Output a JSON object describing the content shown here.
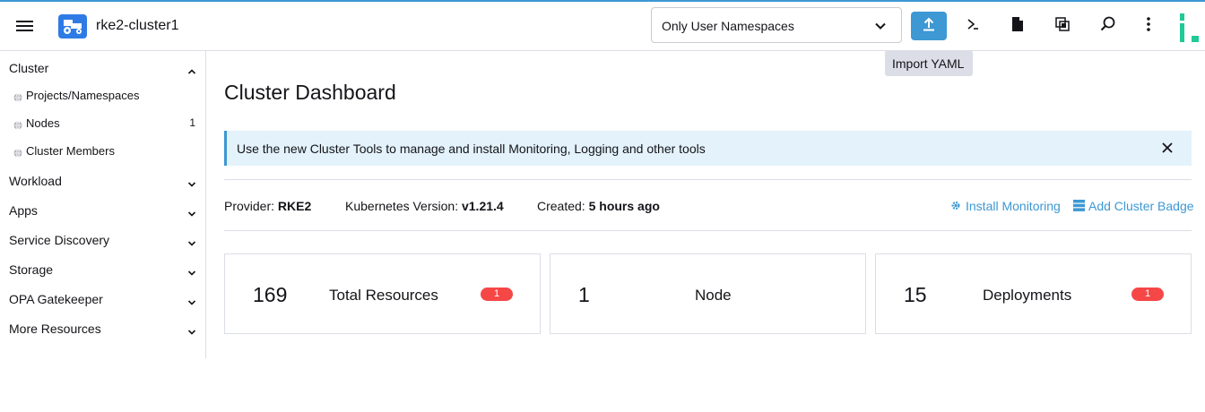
{
  "header": {
    "cluster_name": "rke2-cluster1",
    "namespace_filter": "Only User Namespaces",
    "import_tooltip": "Import YAML",
    "accent_color": "#3d98d3"
  },
  "icons": {
    "menu": "hamburger-menu-icon",
    "logo": "cluster-tractor-logo-icon",
    "import": "upload-icon",
    "shell": "terminal-icon",
    "file": "document-icon",
    "copy": "copy-kubeconfig-icon",
    "search": "search-icon",
    "more": "vertical-ellipsis-icon"
  },
  "sidebar": {
    "cluster_group": "Cluster",
    "cluster_items": [
      {
        "label": "Projects/Namespaces",
        "count": ""
      },
      {
        "label": "Nodes",
        "count": "1"
      },
      {
        "label": "Cluster Members",
        "count": ""
      }
    ],
    "groups": [
      {
        "label": "Workload"
      },
      {
        "label": "Apps"
      },
      {
        "label": "Service Discovery"
      },
      {
        "label": "Storage"
      },
      {
        "label": "OPA Gatekeeper"
      },
      {
        "label": "More Resources"
      }
    ]
  },
  "main": {
    "title": "Cluster Dashboard",
    "banner": "Use the new Cluster Tools to manage and install Monitoring, Logging and other tools",
    "provider_label": "Provider:",
    "provider_value": "RKE2",
    "k8s_label": "Kubernetes Version:",
    "k8s_value": "v1.21.4",
    "created_label": "Created:",
    "created_value": "5 hours ago",
    "install_monitoring": "Install Monitoring",
    "add_badge": "Add Cluster Badge",
    "cards": [
      {
        "count": "169",
        "label": "Total Resources",
        "badge": "1"
      },
      {
        "count": "1",
        "label": "Node",
        "badge": ""
      },
      {
        "count": "15",
        "label": "Deployments",
        "badge": "1"
      }
    ],
    "badge_color": "#f64747"
  }
}
